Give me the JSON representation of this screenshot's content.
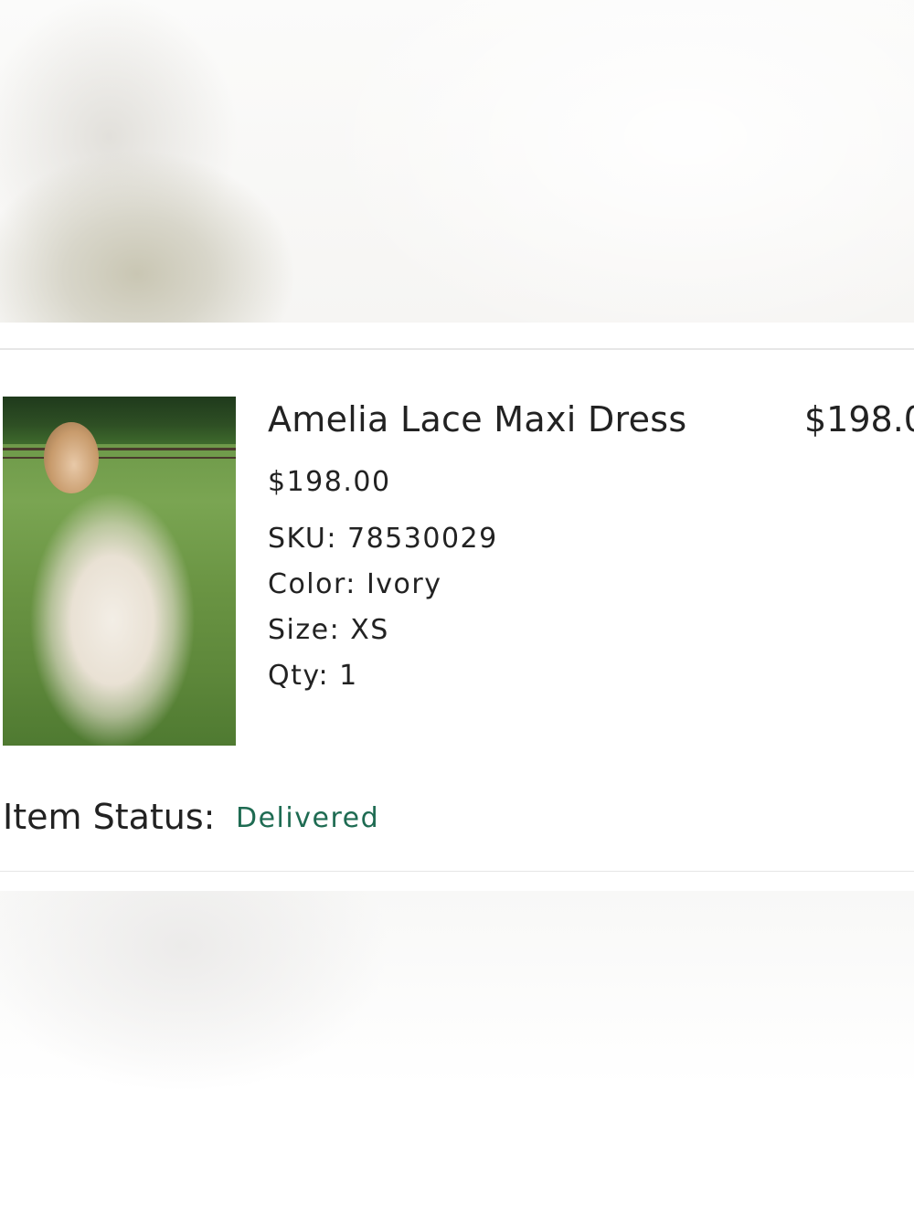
{
  "product": {
    "name": "Amelia Lace Maxi Dress",
    "line_total": "$198.0",
    "unit_price": "$198.00",
    "sku": "SKU: 78530029",
    "color": "Color: Ivory",
    "size": "Size: XS",
    "qty": "Qty: 1",
    "image_icon": "product-photo"
  },
  "status": {
    "label": "Item Status:",
    "value": "Delivered",
    "color": "#1e6b52"
  }
}
